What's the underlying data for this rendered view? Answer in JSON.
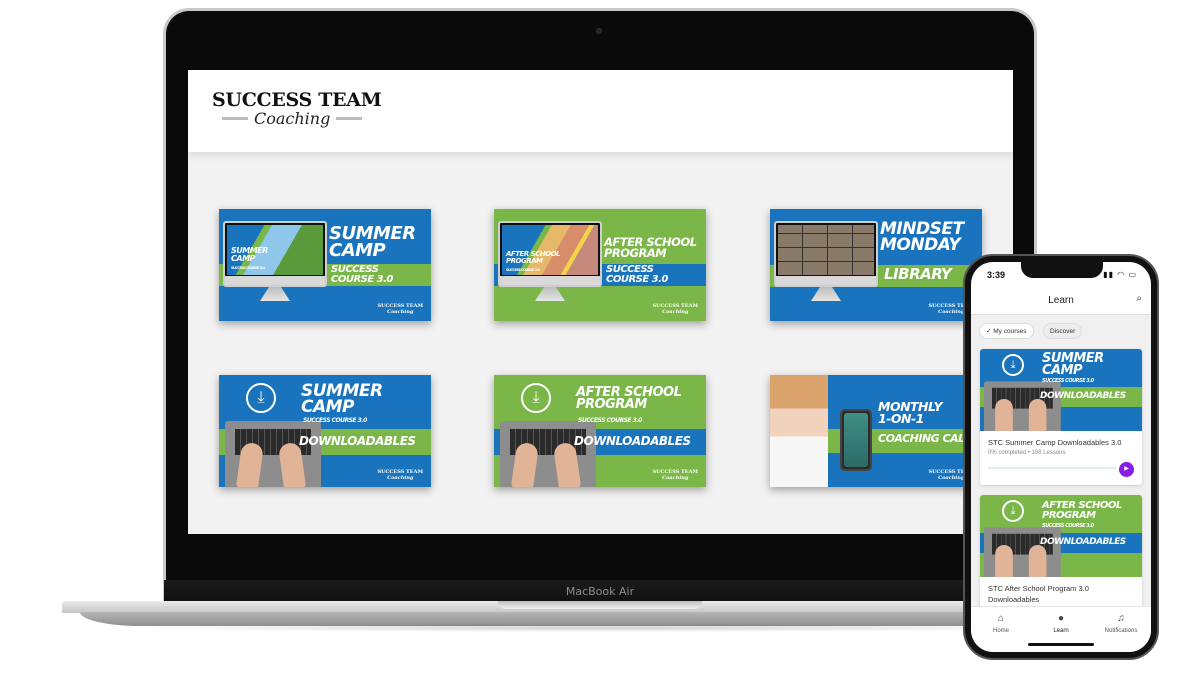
{
  "device": {
    "laptop_label": "MacBook Air"
  },
  "site": {
    "logo_main": "SUCCESS TEAM",
    "logo_sub": "Coaching"
  },
  "tiles": [
    {
      "title_line1": "SUMMER",
      "title_line2": "CAMP",
      "band_text_line1": "SUCCESS",
      "band_text_line2": "COURSE 3.0",
      "screen_title_line1": "SUMMER",
      "screen_title_line2": "CAMP",
      "screen_sub": "SUCCESS COURSE 3.0",
      "brand_line1": "SUCCESS TEAM",
      "brand_line2": "Coaching"
    },
    {
      "title_line1": "AFTER SCHOOL",
      "title_line2": "PROGRAM",
      "band_text_line1": "SUCCESS",
      "band_text_line2": "COURSE 3.0",
      "screen_title_line1": "AFTER SCHOOL",
      "screen_title_line2": "PROGRAM",
      "screen_sub": "SUCCESS COURSE 3.0",
      "brand_line1": "SUCCESS TEAM",
      "brand_line2": "Coaching"
    },
    {
      "title_line1": "MINDSET",
      "title_line2": "MONDAY",
      "band_text": "LIBRARY",
      "brand_line1": "SUCCESS TEAM",
      "brand_line2": "Coaching"
    },
    {
      "title_line1": "SUMMER",
      "title_line2": "CAMP",
      "subtitle": "SUCCESS COURSE 3.0",
      "band_text": "DOWNLOADABLES",
      "brand_line1": "SUCCESS TEAM",
      "brand_line2": "Coaching"
    },
    {
      "title_line1": "AFTER SCHOOL",
      "title_line2": "PROGRAM",
      "subtitle": "SUCCESS COURSE 3.0",
      "band_text": "DOWNLOADABLES",
      "brand_line1": "SUCCESS TEAM",
      "brand_line2": "Coaching"
    },
    {
      "title_line1": "MONTHLY",
      "title_line2": "1-ON-1",
      "band_text": "COACHING CALL",
      "brand_line1": "SUCCESS TEAM",
      "brand_line2": "Coaching"
    }
  ],
  "colors": {
    "brand_blue": "#1a74bd",
    "brand_green": "#7ab648",
    "play_purple": "#8a1be8",
    "progress_green": "#3bb58a"
  },
  "phone": {
    "time": "3:39",
    "status_icons": "signal wifi battery",
    "header_title": "Learn",
    "search_icon": "search-icon",
    "chips": [
      {
        "label": "My courses",
        "selected": true
      },
      {
        "label": "Discover",
        "selected": false
      }
    ],
    "courses": [
      {
        "title": "STC Summer Camp Downloadables 3.0",
        "completed_text": "0% completed",
        "lessons_text": "108 Lessons",
        "progress_percent": 0,
        "img_title_line1": "SUMMER",
        "img_title_line2": "CAMP",
        "img_subtitle": "SUCCESS COURSE 3.0",
        "img_band": "DOWNLOADABLES"
      },
      {
        "title": "STC After School Program 3.0 Downloadables",
        "img_title_line1": "AFTER SCHOOL",
        "img_title_line2": "PROGRAM",
        "img_subtitle": "SUCCESS COURSE 3.0",
        "img_band": "DOWNLOADABLES"
      }
    ],
    "tabs": [
      {
        "label": "Home",
        "icon": "home-icon"
      },
      {
        "label": "Learn",
        "icon": "lightbulb-icon"
      },
      {
        "label": "Notifications",
        "icon": "bell-icon"
      }
    ]
  }
}
